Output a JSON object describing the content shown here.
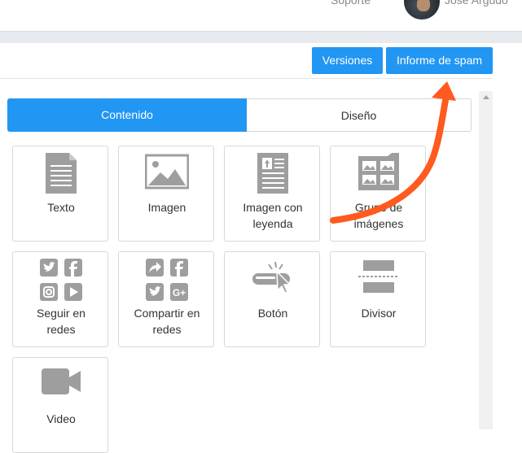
{
  "header": {
    "support_label": "Soporte",
    "user_name": "Jose Argudo"
  },
  "toolbar": {
    "versions_label": "Versiones",
    "spam_report_label": "Informe de spam"
  },
  "tabs": [
    {
      "label": "Contenido",
      "active": true
    },
    {
      "label": "Diseño",
      "active": false
    }
  ],
  "blocks": [
    {
      "label_lines": [
        "Texto"
      ],
      "icon": "text-document-icon"
    },
    {
      "label_lines": [
        "Imagen"
      ],
      "icon": "image-icon"
    },
    {
      "label_lines": [
        "Imagen con",
        "leyenda"
      ],
      "icon": "image-caption-icon"
    },
    {
      "label_lines": [
        "Grupo de",
        "imágenes"
      ],
      "icon": "image-group-icon"
    },
    {
      "label_lines": [
        "Seguir en",
        "redes"
      ],
      "icon": "social-follow-icon"
    },
    {
      "label_lines": [
        "Compartir en",
        "redes"
      ],
      "icon": "social-share-icon"
    },
    {
      "label_lines": [
        "Botón"
      ],
      "icon": "button-click-icon"
    },
    {
      "label_lines": [
        "Divisor"
      ],
      "icon": "divider-icon"
    },
    {
      "label_lines": [
        "Video"
      ],
      "icon": "video-camera-icon"
    }
  ],
  "colors": {
    "accent": "#2196f3",
    "icon_gray": "#9e9e9e",
    "annotation_arrow": "#ff5a1f"
  }
}
